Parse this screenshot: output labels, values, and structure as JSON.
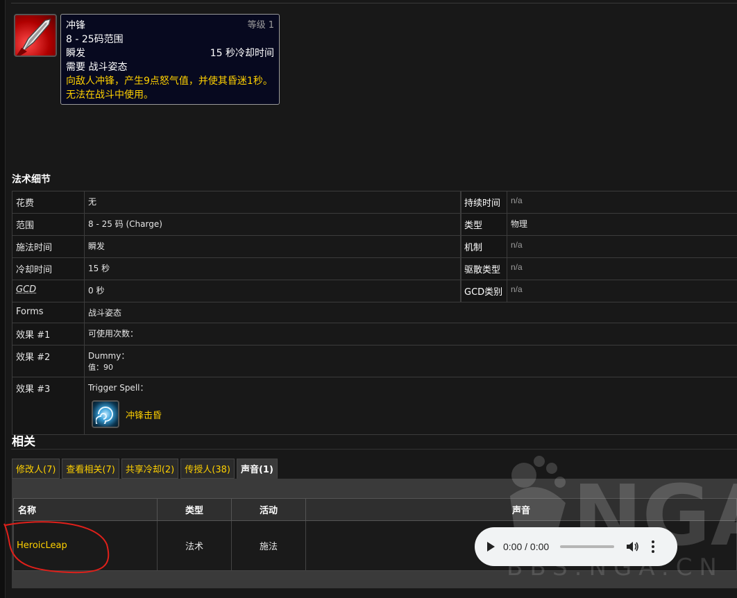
{
  "tooltip": {
    "name": "冲锋",
    "rank": "等级 1",
    "range": "8 - 25码范围",
    "cast": "瞬发",
    "cooldown": "15 秒冷却时间",
    "requires": "需要 战斗姿态",
    "description": "向敌人冲锋，产生9点怒气值，并使其昏迷1秒。无法在战斗中使用。"
  },
  "details_title": "法术细节",
  "details": {
    "rows": [
      {
        "label": "花费",
        "value": "无",
        "r_label": "持续时间",
        "r_value": "n/a"
      },
      {
        "label": "范围",
        "value": "8 - 25 码 (Charge)",
        "r_label": "类型",
        "r_value": "物理"
      },
      {
        "label": "施法时间",
        "value": "瞬发",
        "r_label": "机制",
        "r_value": "n/a"
      },
      {
        "label": "冷却时间",
        "value": "15 秒",
        "r_label": "驱散类型",
        "r_value": "n/a"
      },
      {
        "label": "GCD",
        "value": "0 秒",
        "r_label": "GCD类别",
        "r_value": "n/a"
      }
    ],
    "forms_label": "Forms",
    "forms_value": "战斗姿态",
    "effect1_label": "效果 #1",
    "effect1_value": "可使用次数：",
    "effect2_label": "效果 #2",
    "effect2_value_1": "Dummy：",
    "effect2_value_2": "值：90",
    "effect3_label": "效果 #3",
    "effect3_value": "Trigger Spell：",
    "effect3_spell": "冲锋击昏"
  },
  "related": {
    "title": "相关",
    "tabs": [
      "修改人(7)",
      "查看相关(7)",
      "共享冷却(2)",
      "传授人(38)",
      "声音(1)"
    ],
    "active_tab": 4,
    "columns": [
      "名称",
      "类型",
      "活动",
      "声音"
    ],
    "rows": [
      {
        "name": "HeroicLeap",
        "type": "法术",
        "activity": "施法"
      }
    ]
  },
  "audio": {
    "time": "0:00 / 0:00"
  },
  "watermark": {
    "logo": "NGA",
    "url": "BBS.NGA.CN"
  },
  "colors": {
    "link": "#ffd100",
    "tooltip_bg": "#07091f",
    "annotation": "#e0201a"
  }
}
